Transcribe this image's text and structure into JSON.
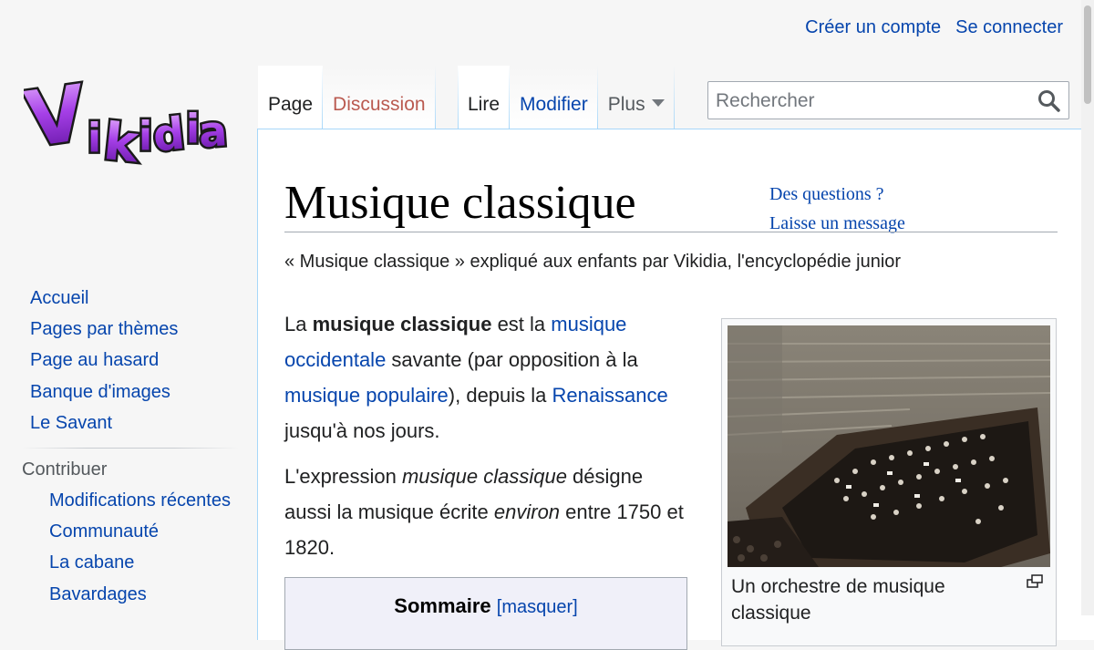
{
  "personal": {
    "create_account": "Créer un compte",
    "login": "Se connecter"
  },
  "logo": {
    "text": "Vikidia"
  },
  "tabs": {
    "page": "Page",
    "discussion": "Discussion",
    "read": "Lire",
    "edit": "Modifier",
    "more": "Plus"
  },
  "search": {
    "placeholder": "Rechercher"
  },
  "sidebar": {
    "main": [
      "Accueil",
      "Pages par thèmes",
      "Page au hasard",
      "Banque d'images",
      "Le Savant"
    ],
    "contribute_heading": "Contribuer",
    "contribute": [
      "Modifications récentes",
      "Communauté",
      "La cabane",
      "Bavardages"
    ]
  },
  "article": {
    "title": "Musique classique",
    "help_questions": "Des questions ?",
    "help_message": "Laisse un message",
    "tagline": "« Musique classique » expliqué aux enfants par Vikidia, l'encyclopédie junior",
    "p1": {
      "t1": "La ",
      "bold": "musique classique",
      "t2": " est la ",
      "link1": "musique occidentale",
      "t3": " savante (par opposition à la ",
      "link2": "musique populaire",
      "t4": "), depuis la ",
      "link3": "Renaissance",
      "t5": " jusqu'à nos jours."
    },
    "p2": {
      "t1": "L'expression ",
      "italic1": "musique classique",
      "t2": " désigne aussi la musique écrite ",
      "italic2": "environ",
      "t3": " entre 1750 et 1820."
    },
    "toc": {
      "title": "Sommaire",
      "hide": "[masquer]"
    },
    "image_caption": "Un orchestre de musique classique"
  },
  "colors": {
    "link": "#0645ad",
    "new_link": "#ba5a50",
    "logo_purple": "#8b2fc9"
  }
}
